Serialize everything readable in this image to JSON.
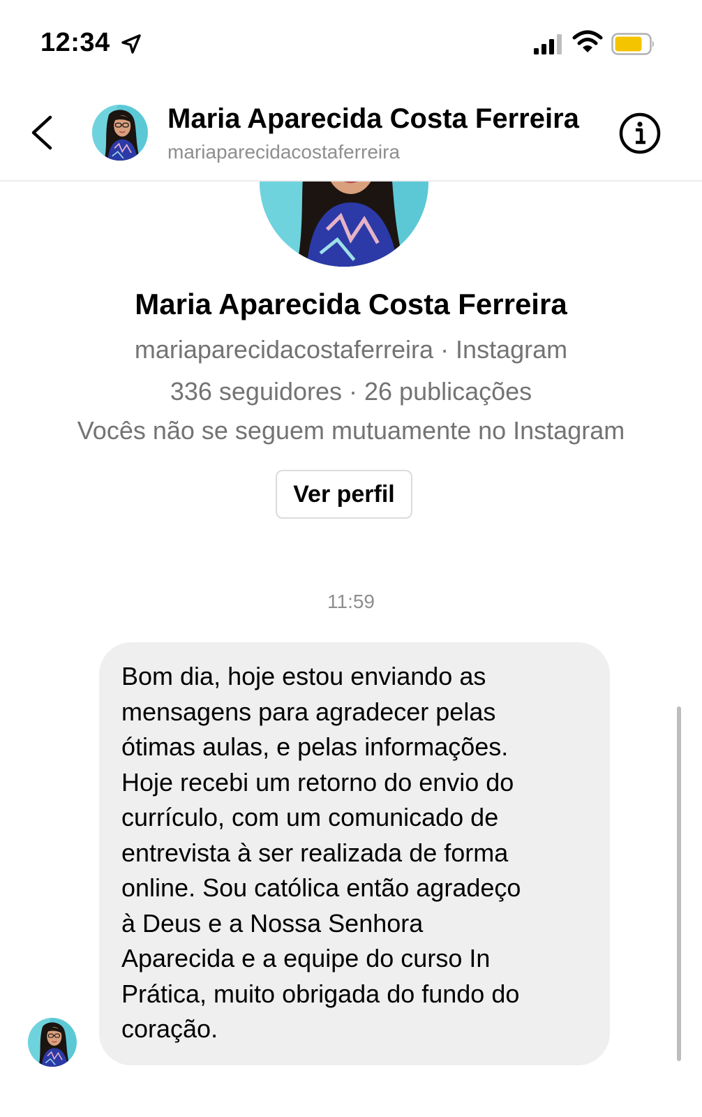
{
  "status_bar": {
    "time": "12:34",
    "icons": [
      "location-arrow-icon",
      "cellular-signal-icon",
      "wifi-icon",
      "battery-icon"
    ],
    "battery_color": "#f5c400"
  },
  "header": {
    "name": "Maria Aparecida Costa Ferreira",
    "username": "mariaparecidacostaferreira",
    "back_icon": "chevron-left-icon",
    "info_icon": "info-icon"
  },
  "profile": {
    "name": "Maria Aparecida Costa Ferreira",
    "source_line": "mariaparecidacostaferreira · Instagram",
    "stats_line": "336 seguidores · 26 publicações",
    "relation_line": "Vocês não se seguem mutuamente no Instagram",
    "view_profile_label": "Ver perfil"
  },
  "conversation": {
    "timestamp": "11:59",
    "message": "Bom dia, hoje estou enviando as\nmensagens para agradecer pelas\nótimas aulas, e pelas informações.\nHoje recebi um retorno do envio do\ncurrículo, com um comunicado de\nentrevista à ser realizada de forma\nonline. Sou católica então agradeço\nà Deus e a Nossa Senhora\nAparecida e a equipe do curso In\nPrática, muito obrigada do fundo do\ncoração.",
    "bubble_color": "#efefef"
  }
}
